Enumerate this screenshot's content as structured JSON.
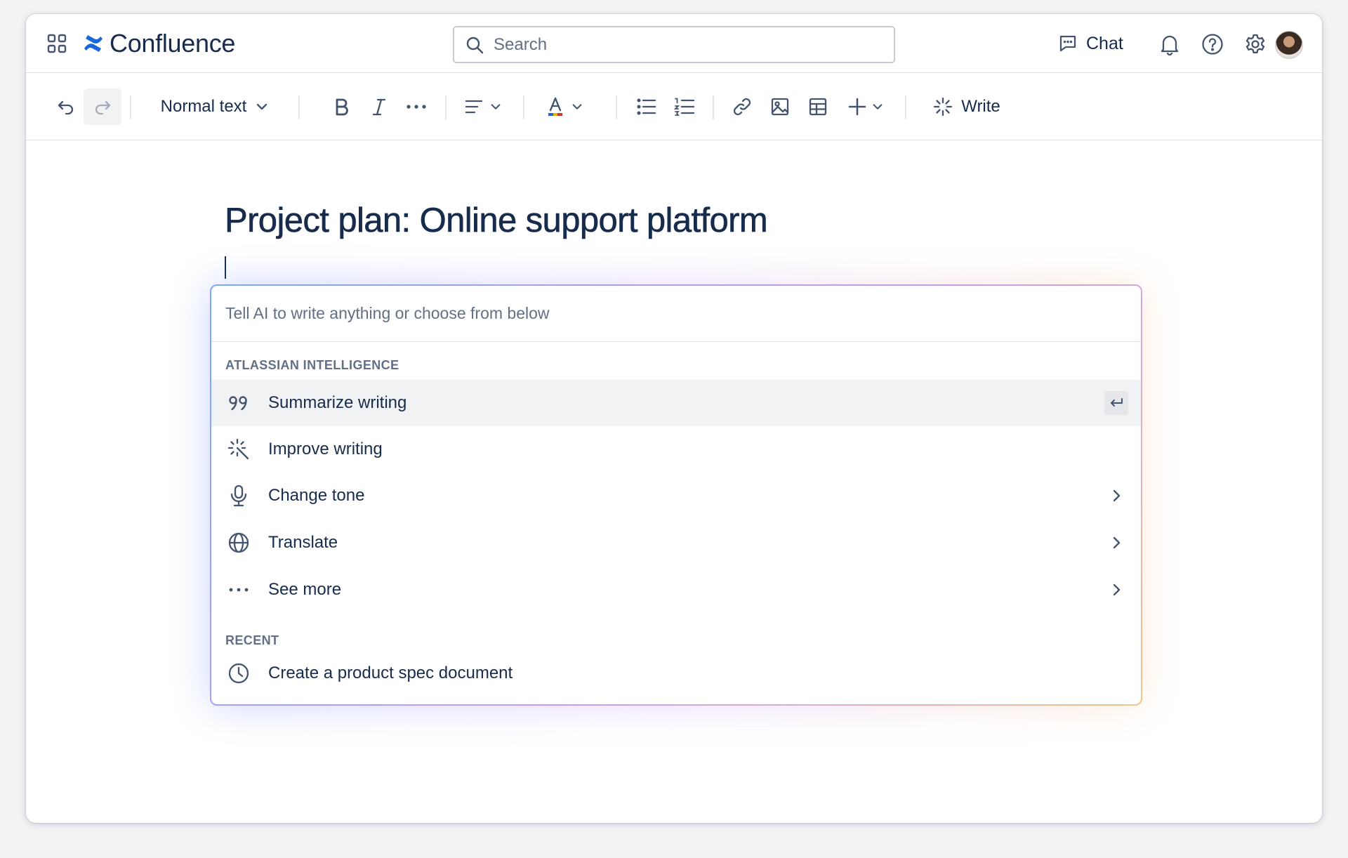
{
  "app": {
    "name": "Confluence"
  },
  "search": {
    "placeholder": "Search"
  },
  "nav": {
    "chat_label": "Chat"
  },
  "toolbar": {
    "text_style": "Normal text",
    "write_label": "Write"
  },
  "page": {
    "title": "Project plan: Online support platform"
  },
  "ai_panel": {
    "input_placeholder": "Tell AI to write anything or choose from below",
    "section_ai": "ATLASSIAN INTELLIGENCE",
    "items": [
      {
        "label": "Summarize writing",
        "icon": "quote-icon",
        "right": "enter-key-icon",
        "selected": true
      },
      {
        "label": "Improve writing",
        "icon": "magic-wand-icon"
      },
      {
        "label": "Change tone",
        "icon": "microphone-icon",
        "right": "chevron-right-icon"
      },
      {
        "label": "Translate",
        "icon": "globe-icon",
        "right": "chevron-right-icon"
      },
      {
        "label": "See more",
        "icon": "more-dots-icon",
        "right": "chevron-right-icon"
      }
    ],
    "section_recent": "RECENT",
    "recent_items": [
      {
        "label": "Create a product spec document",
        "icon": "clock-icon"
      }
    ]
  },
  "colors": {
    "text_primary": "#172b4d",
    "text_subtle": "#626f86",
    "brand_blue": "#1868db",
    "selected_bg": "#f1f2f4"
  }
}
